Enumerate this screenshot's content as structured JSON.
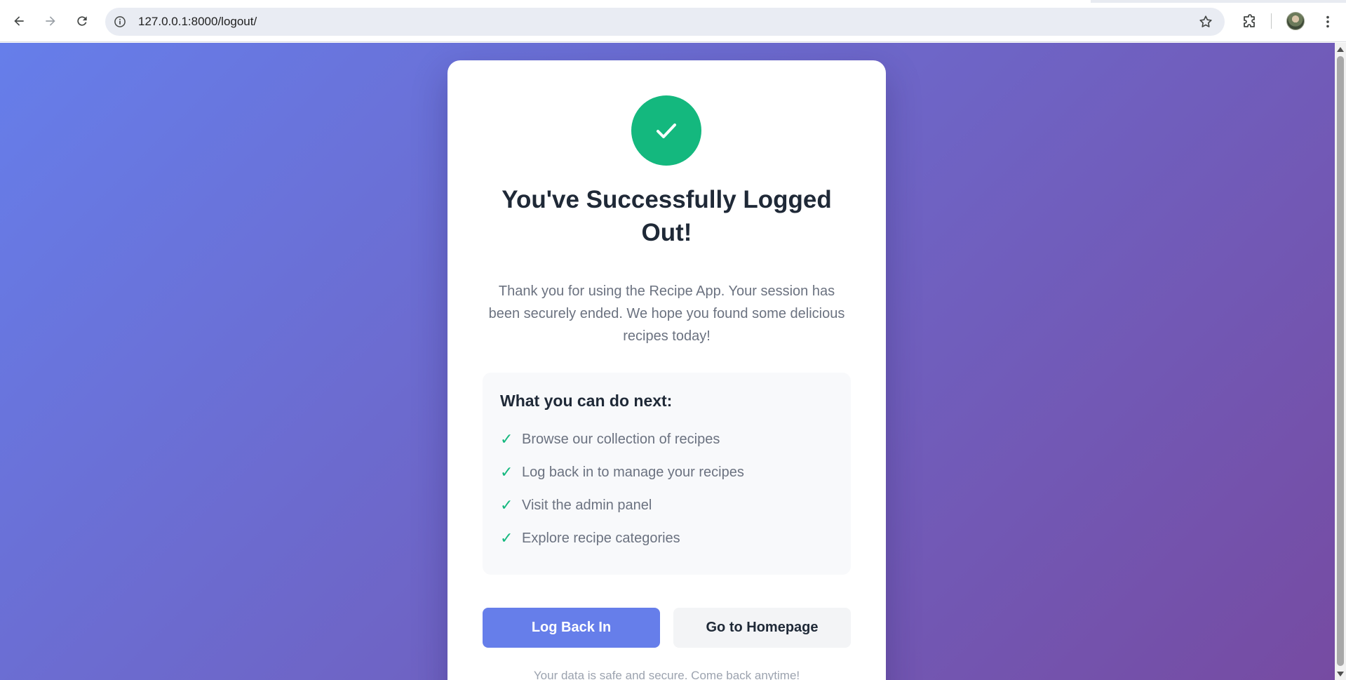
{
  "browser": {
    "url": "127.0.0.1:8000/logout/"
  },
  "page": {
    "title": "You've Successfully Logged Out!",
    "description": "Thank you for using the Recipe App. Your session has been securely ended. We hope you found some delicious recipes today!",
    "next_section": {
      "heading": "What you can do next:",
      "tick_glyph": "✓",
      "items": [
        "Browse our collection of recipes",
        "Log back in to manage your recipes",
        "Visit the admin panel",
        "Explore recipe categories"
      ]
    },
    "buttons": {
      "login_label": "Log Back In",
      "home_label": "Go to Homepage"
    },
    "footer_note": "Your data is safe and secure. Come back anytime!"
  },
  "colors": {
    "gradient_start": "#667eea",
    "gradient_end": "#764ba2",
    "success": "#14b87e",
    "primary_button": "#667eea"
  },
  "icons": {
    "back": "arrow-left-icon",
    "forward": "arrow-right-icon",
    "reload": "reload-icon",
    "site_info": "info-icon",
    "bookmark": "star-icon",
    "extensions": "puzzle-icon",
    "menu": "kebab-menu-icon",
    "success": "checkmark-icon"
  }
}
